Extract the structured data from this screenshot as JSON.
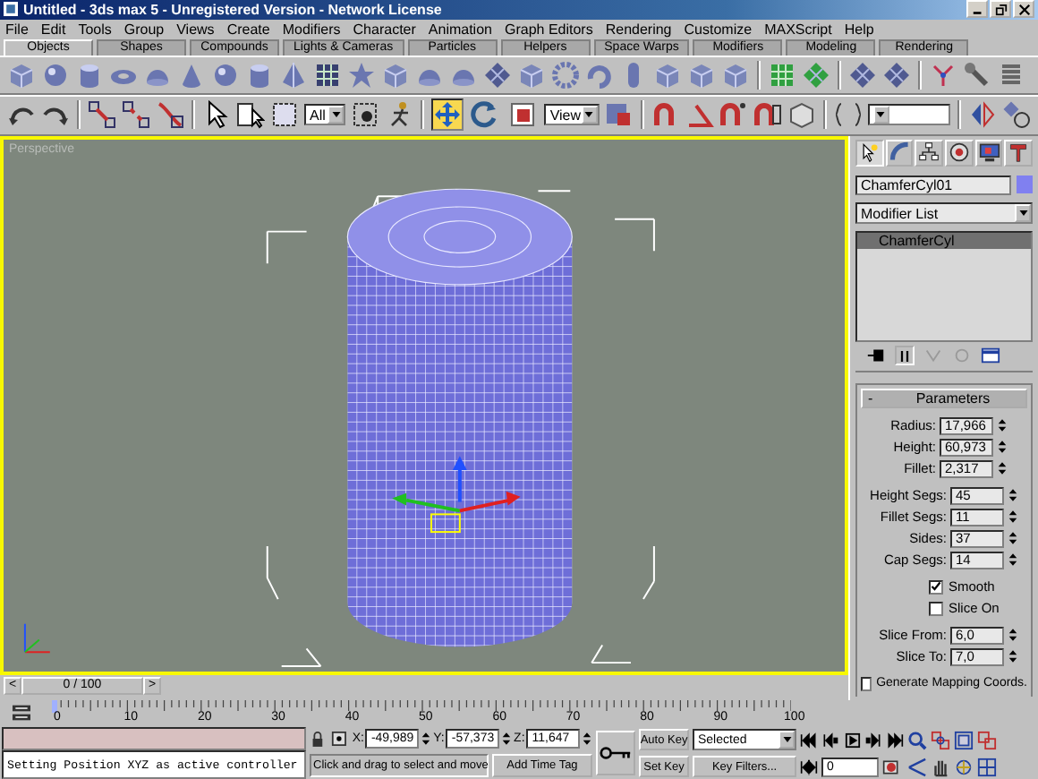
{
  "window": {
    "title": "Untitled - 3ds max 5 - Unregistered Version - Network License"
  },
  "menu": [
    "File",
    "Edit",
    "Tools",
    "Group",
    "Views",
    "Create",
    "Modifiers",
    "Character",
    "Animation",
    "Graph Editors",
    "Rendering",
    "Customize",
    "MAXScript",
    "Help"
  ],
  "tabs": [
    {
      "label": "Objects",
      "selected": true
    },
    {
      "label": "Shapes",
      "selected": false
    },
    {
      "label": "Compounds",
      "selected": false
    },
    {
      "label": "Lights & Cameras",
      "selected": false
    },
    {
      "label": "Particles",
      "selected": false
    },
    {
      "label": "Helpers",
      "selected": false
    },
    {
      "label": "Space Warps",
      "selected": false
    },
    {
      "label": "Modifiers",
      "selected": false
    },
    {
      "label": "Modeling",
      "selected": false
    },
    {
      "label": "Rendering",
      "selected": false
    }
  ],
  "toolbar": {
    "selection_filter": "All",
    "reference_coordinate": "View",
    "transform_tools": [
      {
        "selected": true
      },
      {
        "selected": false
      },
      {
        "selected": false
      }
    ]
  },
  "viewport": {
    "label": "Perspective"
  },
  "command_panel": {
    "tabs": [
      {
        "selected": true
      },
      {
        "selected": false
      },
      {
        "selected": false
      },
      {
        "selected": false
      },
      {
        "selected": false
      },
      {
        "selected": false
      }
    ],
    "object_name": "ChamferCyl01",
    "modifier_list": "Modifier List",
    "stack": [
      {
        "label": "ChamferCyl",
        "selected": true
      }
    ],
    "rollout": {
      "toggle": "-",
      "title": "Parameters"
    },
    "sections": [
      {
        "kind": "spinners",
        "items": [
          {
            "label": "Radius:",
            "value": "17,966"
          },
          {
            "label": "Height:",
            "value": "60,973"
          },
          {
            "label": "Fillet:",
            "value": "2,317"
          }
        ]
      },
      {
        "kind": "spinners",
        "items": [
          {
            "label": "Height Segs:",
            "value": "45"
          },
          {
            "label": "Fillet Segs:",
            "value": "11"
          },
          {
            "label": "Sides:",
            "value": "37"
          },
          {
            "label": "Cap Segs:",
            "value": "14"
          }
        ]
      },
      {
        "kind": "checkboxes",
        "items": [
          {
            "label": "Smooth",
            "checked": true
          },
          {
            "label": "Slice On",
            "checked": false
          }
        ]
      },
      {
        "kind": "spinners",
        "items": [
          {
            "label": "Slice From:",
            "value": "6,0"
          },
          {
            "label": "Slice To:",
            "value": "7,0"
          }
        ]
      },
      {
        "kind": "options",
        "items": [
          {
            "label": "Generate Mapping Coords.",
            "checked": false
          }
        ]
      }
    ]
  },
  "time_slider": {
    "prev": "<",
    "position": "0 / 100",
    "next": ">"
  },
  "track_bar": {
    "ticks": [
      "0",
      "10",
      "20",
      "30",
      "40",
      "50",
      "60",
      "70",
      "80",
      "90",
      "100"
    ]
  },
  "status": {
    "message": "Setting Position XYZ as active controller",
    "coords": [
      {
        "axis": "X:",
        "value": "-49,989"
      },
      {
        "axis": "Y:",
        "value": "-57,373"
      },
      {
        "axis": "Z:",
        "value": "11,647"
      }
    ],
    "prompt": "Click and drag to select and move",
    "time_tag": "Add Time Tag",
    "auto_key": "Auto Key",
    "set_key": "Set Key",
    "key_mode": "Selected",
    "key_filters": "Key Filters...",
    "frame": "0"
  }
}
